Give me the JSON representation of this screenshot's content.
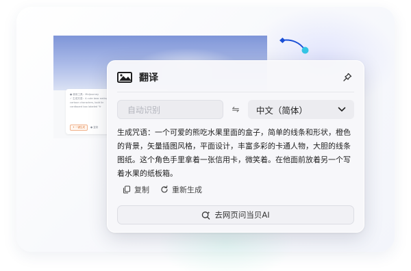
{
  "background_page": {
    "lines": [
      "● 使用工具：Midjourney",
      "✓ 生成咒语：A cute bear eating",
      "cartoon characters, bold lin",
      "cardboard box labeled \"fr"
    ],
    "chip_primary": "✦ 一键生成",
    "chip_secondary": "● 复制"
  },
  "panel": {
    "title": "翻译",
    "source_placeholder": "自动识别",
    "swap_symbol": "⇋",
    "target_language": "中文（简体）",
    "result_text": "生成咒语：一个可爱的熊吃水果里面的盒子，简单的线条和形状，橙色的背景，矢量插图风格，平面设计，丰富多彩的卡通人物，大胆的线条图纸。这个角色手里拿着一张信用卡，微笑着。在他面前放着另一个写着水果的纸板箱。",
    "copy_label": "复制",
    "regenerate_label": "重新生成",
    "ask_label": "去网页问当贝AI"
  },
  "colors": {
    "accent": "#2aa1f0",
    "connector_dot_start": "#1a4fd6",
    "connector_dot_end": "#34c6e6"
  },
  "icons": {
    "logo": "translate-logo-icon",
    "pin": "pin-icon",
    "swap": "swap-icon",
    "dropdown": "chevron-down-icon",
    "copy": "copy-icon",
    "regenerate": "refresh-icon",
    "ask": "ai-search-icon"
  }
}
